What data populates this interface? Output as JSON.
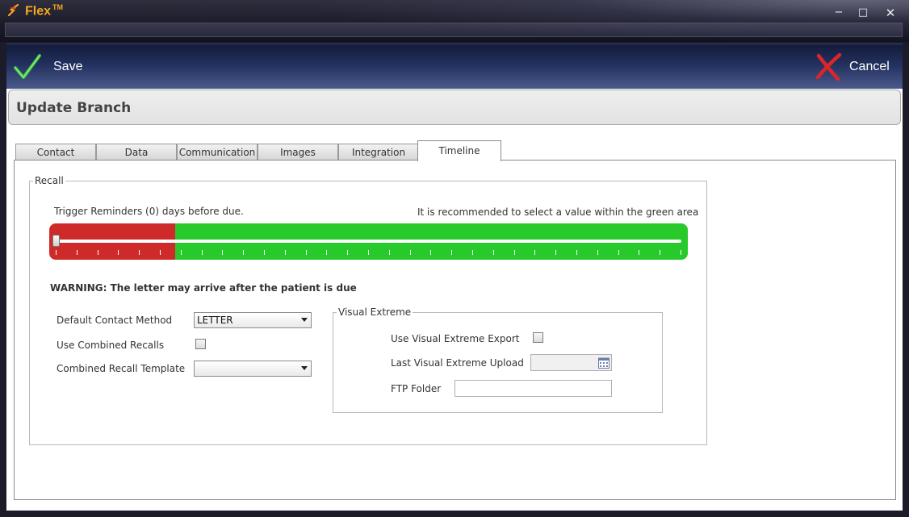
{
  "window": {
    "title": "Flex",
    "trademark": "TM",
    "minimize": "−",
    "maximize": "□",
    "close": "✕"
  },
  "toolbar": {
    "save_label": "Save",
    "cancel_label": "Cancel"
  },
  "page": {
    "title": "Update Branch"
  },
  "tabs": [
    {
      "label": "Contact",
      "active": false
    },
    {
      "label": "Data",
      "active": false
    },
    {
      "label": "Communication",
      "active": false
    },
    {
      "label": "Images",
      "active": false
    },
    {
      "label": "Integration",
      "active": false
    },
    {
      "label": "Timeline",
      "active": true
    }
  ],
  "recall": {
    "legend": "Recall",
    "trigger_text": "Trigger Reminders (0) days before due.",
    "recommend_text": "It is recommended to select a value within the green area",
    "slider": {
      "value": 0,
      "red_zone_fraction": 0.2,
      "tick_count": 31,
      "colors": {
        "red": "#cf2a2a",
        "green": "#27c92b"
      }
    },
    "warning": "WARNING: The letter may arrive after the patient is due",
    "default_contact_method_label": "Default Contact Method",
    "default_contact_method_value": "LETTER",
    "use_combined_recalls_label": "Use Combined Recalls",
    "use_combined_recalls_checked": false,
    "combined_recall_template_label": "Combined Recall Template",
    "combined_recall_template_value": ""
  },
  "visual_extreme": {
    "legend": "Visual Extreme",
    "export_label": "Use Visual Extreme Export",
    "export_checked": false,
    "last_upload_label": "Last Visual Extreme Upload",
    "last_upload_value": "",
    "ftp_folder_label": "FTP Folder",
    "ftp_folder_value": ""
  },
  "colors": {
    "brand": "#f5a623",
    "toolbar_dark": "#141b3a",
    "save_check": "#3cc23c",
    "cancel_x": "#d8262a"
  }
}
